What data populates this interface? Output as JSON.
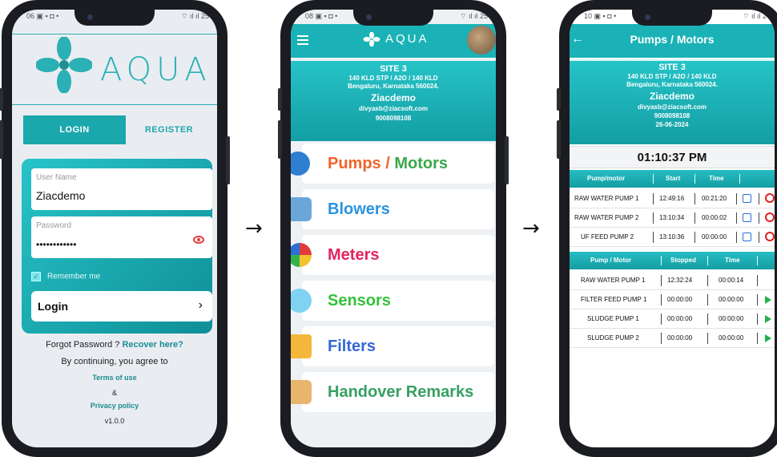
{
  "login": {
    "logo_text": "AQUA",
    "tabs": {
      "login": "LOGIN",
      "register": "REGISTER"
    },
    "username_label": "User Name",
    "username_value": "Ziacdemo",
    "password_label": "Password",
    "password_value": "••••••••••••",
    "remember_label": "Remember me",
    "login_button": "Login",
    "forgot_text": "Forgot Password ?",
    "recover_link": "Recover here?",
    "agree_text": "By continuing, you agree to",
    "terms_link": "Terms of use",
    "amp": "&",
    "privacy_link": "Privacy policy",
    "version": "v1.0.0",
    "brand_color": "#1ba8ad"
  },
  "arrows": {
    "first": "→",
    "second": "→"
  },
  "menu_screen": {
    "brand": "AQUA",
    "site": {
      "name": "SITE 3",
      "details": "140 KLD STP / A2O / 140 KLD",
      "address": "Bengaluru, Karnataka 560024.",
      "company": "Ziacdemo",
      "email": "divyasb@ziacsoft.com",
      "phone": "9008098108"
    },
    "items": [
      {
        "label_a": "Pumps / ",
        "label_b": "Motors",
        "color_a": "#f0642a",
        "color_b": "#3aa84a",
        "icon": "pump-icon"
      },
      {
        "label": "Blowers",
        "color": "#2a93e0",
        "icon": "blower-icon"
      },
      {
        "label": "Meters",
        "color": "#e2245e",
        "icon": "meter-icon"
      },
      {
        "label": "Sensors",
        "color": "#34c23c",
        "icon": "sensor-icon"
      },
      {
        "label": "Filters",
        "color": "#3567d6",
        "icon": "filter-icon"
      },
      {
        "label": "Handover Remarks",
        "color": "#37a062",
        "icon": "handover-icon"
      }
    ]
  },
  "pumps_screen": {
    "title": "Pumps / Motors",
    "back": "←",
    "site": {
      "name": "SITE 3",
      "details": "140 KLD STP / A2O / 140 KLD",
      "address": "Bengaluru, Karnataka 560024.",
      "company": "Ziacdemo",
      "email": "divyasb@ziacsoft.com",
      "phone": "9008098108",
      "date": "26-06-2024"
    },
    "clock": "01:10:37 PM",
    "running_headers": {
      "name": "Pump/motor",
      "start": "Start",
      "time": "Time"
    },
    "running": [
      {
        "name": "RAW WATER PUMP 1",
        "start": "12:49:16",
        "time": "00:21:20"
      },
      {
        "name": "RAW WATER PUMP 2",
        "start": "13:10:34",
        "time": "00:00:02"
      },
      {
        "name": "UF FEED PUMP 2",
        "start": "13:10:36",
        "time": "00:00:00"
      }
    ],
    "stopped_headers": {
      "name": "Pump / Motor",
      "stopped": "Stopped",
      "time": "Time"
    },
    "stopped": [
      {
        "name": "RAW WATER PUMP 1",
        "stopped": "12:32:24",
        "time": "00:00:14"
      },
      {
        "name": "FILTER FEED PUMP 1",
        "stopped": "00:00:00",
        "time": "00:00:00"
      },
      {
        "name": "SLUDGE PUMP 1",
        "stopped": "00:00:00",
        "time": "00:00:00"
      },
      {
        "name": "SLUDGE PUMP 2",
        "stopped": "00:00:00",
        "time": "00:00:00"
      }
    ]
  }
}
